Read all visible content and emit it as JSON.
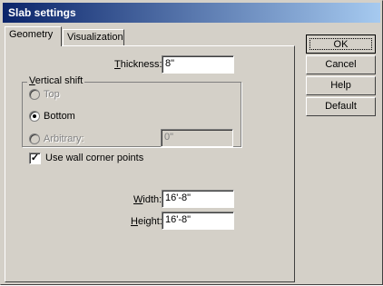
{
  "window": {
    "title": "Slab settings"
  },
  "tabs": [
    {
      "label": "Geometry",
      "active": true
    },
    {
      "label": "Visualization",
      "active": false
    }
  ],
  "geometry": {
    "thickness_label_mnemonic": "T",
    "thickness_label_rest": "hickness:",
    "thickness_value": "8\"",
    "vertical_shift_mnemonic": "V",
    "vertical_shift_rest": "ertical shift",
    "radio_top": {
      "label": "Top",
      "selected": false,
      "enabled": false
    },
    "radio_bottom": {
      "label": "Bottom",
      "selected": true,
      "enabled": true
    },
    "radio_arbitrary": {
      "label": "Arbitrary:",
      "selected": false,
      "enabled": false
    },
    "arbitrary_value": "0\"",
    "use_wall_corner": {
      "label": "Use wall corner points",
      "checked": true
    },
    "width_label_mnemonic": "W",
    "width_label_rest": "idth:",
    "width_value": "16'-8\"",
    "height_label_mnemonic": "H",
    "height_label_rest": "eight:",
    "height_value": "16'-8\""
  },
  "buttons": {
    "ok": "OK",
    "cancel": "Cancel",
    "help": "Help",
    "default": "Default"
  },
  "colors": {
    "title_start": "#0a246a",
    "title_end": "#a6caf0",
    "face": "#d4d0c8"
  }
}
